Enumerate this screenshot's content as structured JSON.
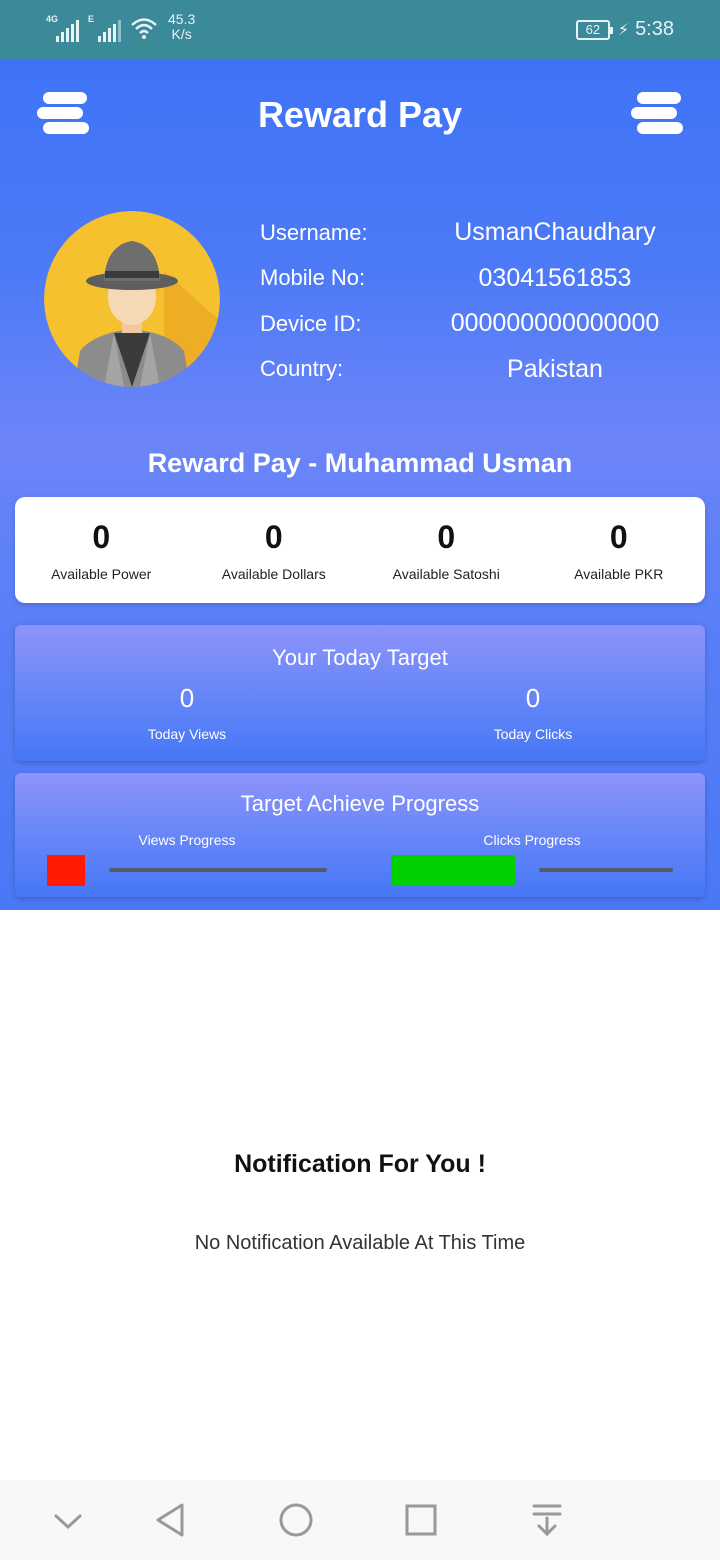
{
  "status_bar": {
    "network_1": "4G",
    "network_2": "E",
    "speed_value": "45.3",
    "speed_unit": "K/s",
    "battery": "62",
    "time": "5:38"
  },
  "header": {
    "title": "Reward Pay",
    "left_icon": "menu-icon",
    "right_icon": "menu-icon"
  },
  "profile": {
    "rows": [
      {
        "label": "Username:",
        "value": "UsmanChaudhary"
      },
      {
        "label": "Mobile No:",
        "value": "03041561853"
      },
      {
        "label": "Device ID:",
        "value": "000000000000000"
      },
      {
        "label": "Country:",
        "value": "Pakistan"
      }
    ]
  },
  "subtitle": "Reward Pay - Muhammad Usman",
  "balances": [
    {
      "value": "0",
      "label": "Available Power"
    },
    {
      "value": "0",
      "label": "Available Dollars"
    },
    {
      "value": "0",
      "label": "Available Satoshi"
    },
    {
      "value": "0",
      "label": "Available PKR"
    }
  ],
  "today_target": {
    "title": "Your Today Target",
    "views_value": "0",
    "views_label": "Today Views",
    "clicks_value": "0",
    "clicks_label": "Today Clicks"
  },
  "progress": {
    "title": "Target Achieve Progress",
    "views_label": "Views Progress",
    "clicks_label": "Clicks Progress",
    "views_color": "#ff1a00",
    "clicks_color": "#00d000"
  },
  "notifications": {
    "title": "Notification For You !",
    "empty_text": "No Notification Available At This Time"
  },
  "colors": {
    "status_bar": "#3a8a9a",
    "accent_blue": "#4677f6"
  }
}
